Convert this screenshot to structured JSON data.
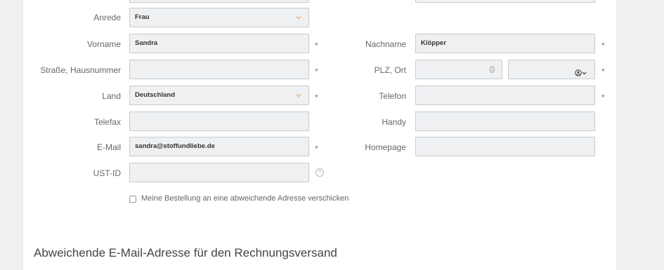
{
  "form": {
    "salutation": {
      "label": "Anrede",
      "value": "Frau"
    },
    "first_name": {
      "label": "Vorname",
      "value": "Sandra",
      "required": "*"
    },
    "last_name": {
      "label": "Nachname",
      "value": "Klöpper",
      "required": "*"
    },
    "street": {
      "label": "Straße, Hausnummer",
      "value": "",
      "required": "*"
    },
    "zip_city": {
      "label": "PLZ, Ort",
      "zip_value": "",
      "city_value": "",
      "required": "*"
    },
    "country": {
      "label": "Land",
      "value": "Deutschland",
      "required": "*"
    },
    "phone": {
      "label": "Telefon",
      "value": "",
      "required": "*"
    },
    "fax": {
      "label": "Telefax",
      "value": ""
    },
    "mobile": {
      "label": "Handy",
      "value": ""
    },
    "email": {
      "label": "E-Mail",
      "value": "sandra@stoffundliebe.de",
      "required": "*"
    },
    "homepage": {
      "label": "Homepage",
      "value": ""
    },
    "vat_id": {
      "label": "UST-ID",
      "value": "",
      "help": "?"
    },
    "alt_address_checkbox": {
      "label": "Meine Bestellung an eine abweichende Adresse verschicken",
      "checked": false
    }
  },
  "section": {
    "title": "Abweichende E-Mail-Adresse für den Rechnungsversand"
  },
  "colors": {
    "accent": "#f0a05a",
    "field_bg": "#eef0f2",
    "border": "#c7cbcf"
  }
}
